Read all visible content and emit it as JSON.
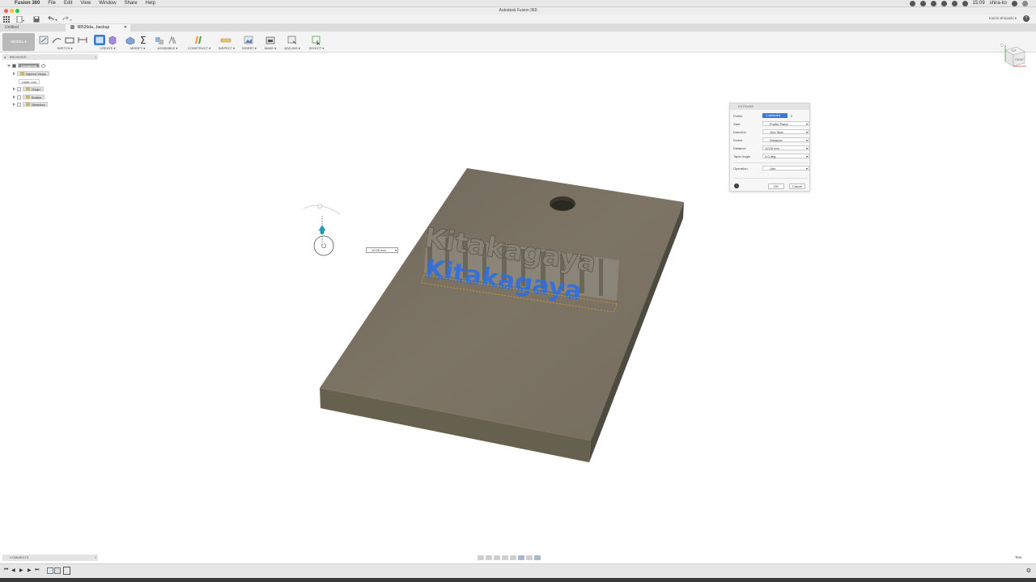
{
  "menubar": {
    "app_name": "Fusion 360",
    "items": [
      "File",
      "Edit",
      "View",
      "Window",
      "Share",
      "Help"
    ],
    "clock": "15:09",
    "user": "shira-ko"
  },
  "window": {
    "title": "Autodesk Fusion 360"
  },
  "account": {
    "name": "Koichi Shiraishi ▾",
    "help": "?"
  },
  "tabs": [
    {
      "label": "Untitled"
    },
    {
      "label": "98526da...backup"
    }
  ],
  "toolbar": {
    "workspace": "MODEL ▾",
    "groups": [
      "SKETCH ▾",
      "CREATE ▾",
      "MODIFY ▾",
      "ASSEMBLE ▾",
      "CONSTRUCT ▾",
      "INSPECT ▾",
      "INSERT ▾",
      "MAKE ▾",
      "ADD-INS ▾",
      "SELECT ▾"
    ]
  },
  "browser": {
    "title": "BROWSER",
    "root": "(Unsaved)",
    "items": [
      "Named Views",
      "Units: mm",
      "Origin",
      "Bodies",
      "Sketches"
    ]
  },
  "model": {
    "text": "Kitakagaya",
    "accent": "#2f6fe0",
    "base_color": "#7b7263"
  },
  "dimension": {
    "value": "10.00 mm"
  },
  "extrude": {
    "title": "EXTRUDE",
    "rows": [
      {
        "label": "Profile",
        "value": "1 selected"
      },
      {
        "label": "Start",
        "value": "Profile Plane"
      },
      {
        "label": "Direction",
        "value": "One Side"
      },
      {
        "label": "Extent",
        "value": "Distance"
      },
      {
        "label": "Distance",
        "value": "10.00 mm"
      },
      {
        "label": "Taper Angle",
        "value": "0.0 deg"
      },
      {
        "label": "Operation",
        "value": "Join"
      }
    ],
    "ok": "OK",
    "cancel": "Cancel"
  },
  "comments": {
    "title": "COMMENTS"
  },
  "status": {
    "text_label": "Text"
  },
  "viewcube": {
    "face_front": "FRONT",
    "face_top": "TOP"
  }
}
